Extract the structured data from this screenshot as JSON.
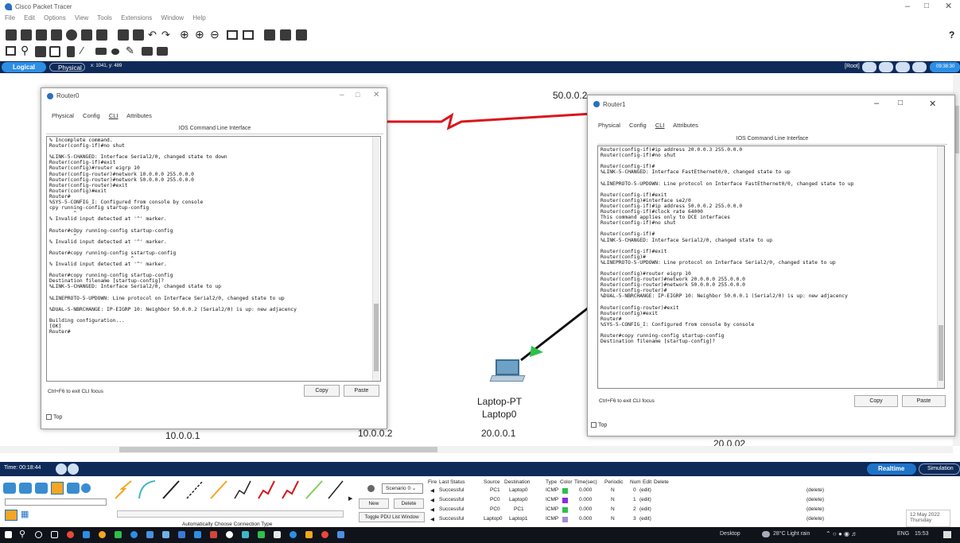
{
  "app": {
    "title": "Cisco Packet Tracer"
  },
  "menu": [
    "File",
    "Edit",
    "Options",
    "View",
    "Tools",
    "Extensions",
    "Window",
    "Help"
  ],
  "help_mark": "?",
  "workbar": {
    "logical": "Logical",
    "physical": "Physical",
    "coords": "x: 1041, y: 489",
    "root": "[Root]",
    "clock": "09:38:30"
  },
  "router0": {
    "title": "Router0",
    "tabs": [
      "Physical",
      "Config",
      "CLI",
      "Attributes"
    ],
    "cli_header": "IOS Command Line Interface",
    "cli_text": "% Incomplete command.\nRouter(config-if)#no shut\n\n%LINK-5-CHANGED: Interface Serial2/0, changed state to down\nRouter(config-if)#exit\nRouter(config)#router eigrp 10\nRouter(config-router)#network 10.0.0.0 255.0.0.0\nRouter(config-router)#network 50.0.0.0 255.0.0.0\nRouter(config-router)#exit\nRouter(config)#exit\nRouter#\n%SYS-5-CONFIG_I: Configured from console by console\ncpy running-config startup-config\n        ^\n% Invalid input detected at '^' marker.\n\nRouter#cOpy running-config startup-config\n        ^\n% Invalid input detected at '^' marker.\n\nRouter#copy running-config sstartup-config\n                           ^\n% Invalid input detected at '^' marker.\n\nRouter#copy running-config startup-config\nDestination filename [startup-config]?\n%LINK-5-CHANGED: Interface Serial2/0, changed state to up\n\n%LINEPROTO-5-UPDOWN: Line protocol on Interface Serial2/0, changed state to up\n\n%DUAL-5-NBRCHANGE: IP-EIGRP 10: Neighbor 50.0.0.2 (Serial2/0) is up: new adjacency\n\nBuilding configuration...\n[OK]\nRouter#",
    "hint": "Ctrl+F6 to exit CLI focus",
    "copy": "Copy",
    "paste": "Paste",
    "top": "Top"
  },
  "router1": {
    "title": "Router1",
    "tabs": [
      "Physical",
      "Config",
      "CLI",
      "Attributes"
    ],
    "cli_header": "IOS Command Line Interface",
    "cli_text": "Router(config-if)#ip address 20.0.0.3 255.0.0.0\nRouter(config-if)#no shut\n\nRouter(config-if)#\n%LINK-5-CHANGED: Interface FastEthernet0/0, changed state to up\n\n%LINEPROTO-5-UPDOWN: Line protocol on Interface FastEthernet0/0, changed state to up\n\nRouter(config-if)#exit\nRouter(config)#interface se2/0\nRouter(config-if)#ip address 50.0.0.2 255.0.0.0\nRouter(config-if)#clock rate 64000\nThis command applies only to DCE interfaces\nRouter(config-if)#no shut\n\nRouter(config-if)#\n%LINK-5-CHANGED: Interface Serial2/0, changed state to up\n\nRouter(config-if)#exit\nRouter(config)#\n%LINEPROTO-5-UPDOWN: Line protocol on Interface Serial2/0, changed state to up\n\nRouter(config)#router eigrp 10\nRouter(config-router)#network 20.0.0.0 255.0.0.0\nRouter(config-router)#network 50.0.0.0 255.0.0.0\nRouter(config-router)#\n%DUAL-5-NBRCHANGE: IP-EIGRP 10: Neighbor 50.0.0.1 (Serial2/0) is up: new adjacency\n\nRouter(config-router)#exit\nRouter(config)#exit\nRouter#\n%SYS-5-CONFIG_I: Configured from console by console\n\nRouter#copy running-config startup-config\nDestination filename [startup-config]?",
    "hint": "Ctrl+F6 to exit CLI focus",
    "copy": "Copy",
    "paste": "Paste",
    "top": "Top"
  },
  "topology": {
    "label_serial_top": "50.0.0.2",
    "laptop_name": "Laptop-PT",
    "laptop_label": "Laptop0",
    "ip_a": "10.0.0.1",
    "ip_b": "10.0.0.2",
    "ip_c": "20.0.0.1",
    "ip_d": "20.0.02"
  },
  "timebar": {
    "time": "Time: 00:18:44",
    "realtime": "Realtime",
    "simulation": "Simulation"
  },
  "bottom": {
    "connection_hint": "Automatically Choose Connection Type",
    "scenario": "Scenario 0",
    "new": "New",
    "delete": "Delete",
    "toggle_pdu": "Toggle PDU List Window",
    "pdu_headers": [
      "Fire",
      "Last Status",
      "Source",
      "Destination",
      "Type",
      "Color",
      "Time(sec)",
      "Periodic",
      "Num",
      "Edit",
      "Delete"
    ],
    "pdu_rows": [
      {
        "status": "Successful",
        "source": "PC1",
        "dest": "Laptop0",
        "type": "ICMP",
        "color": "#2fbf4a",
        "time": "0.000",
        "periodic": "N",
        "num": "0",
        "edit": "(edit)",
        "delete": "(delete)"
      },
      {
        "status": "Successful",
        "source": "PC0",
        "dest": "Laptop0",
        "type": "ICMP",
        "color": "#8a2be2",
        "time": "0.000",
        "periodic": "N",
        "num": "1",
        "edit": "(edit)",
        "delete": "(delete)"
      },
      {
        "status": "Successful",
        "source": "PC0",
        "dest": "PC1",
        "type": "ICMP",
        "color": "#2fbf4a",
        "time": "0.000",
        "periodic": "N",
        "num": "2",
        "edit": "(edit)",
        "delete": "(delete)"
      },
      {
        "status": "Successful",
        "source": "Laptop0",
        "dest": "Laptop1",
        "type": "ICMP",
        "color": "#a58cd6",
        "time": "0.000",
        "periodic": "N",
        "num": "3",
        "edit": "(edit)",
        "delete": "(delete)"
      }
    ]
  },
  "taskbar": {
    "desktop": "Desktop",
    "weather": "28°C Light rain",
    "lang": "ENG",
    "time": "15:53",
    "date": "12 May 2022",
    "day": "Thursday"
  },
  "colors": {
    "serial_link": "#d9161b",
    "header_bar": "#0e2a58",
    "realtime": "#1e73c8",
    "link_up": "#2fbf4a"
  }
}
